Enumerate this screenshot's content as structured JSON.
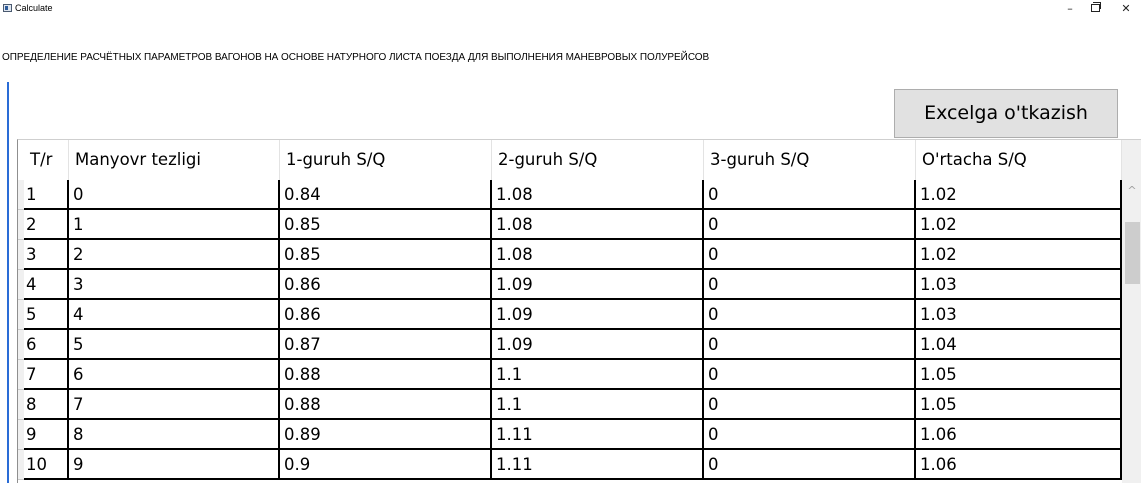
{
  "window": {
    "title": "Calculate",
    "minimize_glyph": "–",
    "close_glyph": "✕"
  },
  "heading": "ОПРЕДЕЛЕНИЕ РАСЧЁТНЫХ ПАРАМЕТРОВ ВАГОНОВ НА ОСНОВЕ НАТУРНОГО ЛИСТА ПОЕЗДА ДЛЯ ВЫПОЛНЕНИЯ МАНЕВРОВЫХ ПОЛУРЕЙСОВ",
  "export_button": "Excelga o'tkazish",
  "table": {
    "columns": [
      "T/r",
      "Manyovr tezligi",
      "1-guruh S/Q",
      "2-guruh S/Q",
      "3-guruh S/Q",
      "O'rtacha S/Q"
    ],
    "rows": [
      [
        "1",
        "0",
        "0.84",
        "1.08",
        "0",
        "1.02"
      ],
      [
        "2",
        "1",
        "0.85",
        "1.08",
        "0",
        "1.02"
      ],
      [
        "3",
        "2",
        "0.85",
        "1.08",
        "0",
        "1.02"
      ],
      [
        "4",
        "3",
        "0.86",
        "1.09",
        "0",
        "1.03"
      ],
      [
        "5",
        "4",
        "0.86",
        "1.09",
        "0",
        "1.03"
      ],
      [
        "6",
        "5",
        "0.87",
        "1.09",
        "0",
        "1.04"
      ],
      [
        "7",
        "6",
        "0.88",
        "1.1",
        "0",
        "1.05"
      ],
      [
        "8",
        "7",
        "0.88",
        "1.1",
        "0",
        "1.05"
      ],
      [
        "9",
        "8",
        "0.89",
        "1.11",
        "0",
        "1.06"
      ],
      [
        "10",
        "9",
        "0.9",
        "1.11",
        "0",
        "1.06"
      ]
    ]
  },
  "scrollbar": {
    "up_glyph": "^"
  },
  "colors": {
    "accent_rule": "#2a6cd6",
    "button_bg": "#e1e1e1",
    "grid_lines": "#000000"
  }
}
